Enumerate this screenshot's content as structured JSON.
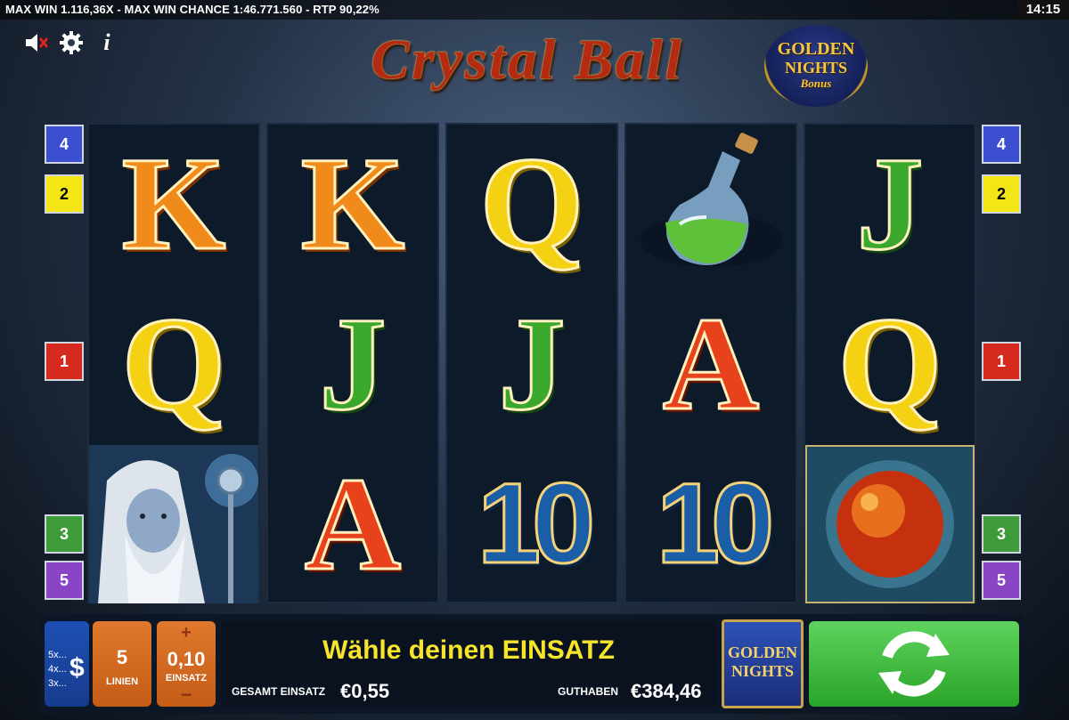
{
  "topbar": {
    "info": "MAX WIN 1.116,36X  -  MAX WIN CHANCE 1:46.771.560  -  RTP 90,22%",
    "clock": "14:15"
  },
  "icons": [
    "sound-off-icon",
    "gear-icon",
    "info-icon"
  ],
  "game": {
    "title": "Crystal Ball",
    "badge": {
      "line1": "GOLDEN",
      "line2": "NIGHTS",
      "line3": "Bonus"
    }
  },
  "reels": [
    [
      "K",
      "Q",
      "wizard"
    ],
    [
      "K",
      "J",
      "A"
    ],
    [
      "Q",
      "J",
      "10"
    ],
    [
      "potion",
      "A",
      "10"
    ],
    [
      "J",
      "Q",
      "crystal-ball"
    ]
  ],
  "paylines_left": [
    {
      "label": "4",
      "color": "#3d4fd1"
    },
    {
      "label": "2",
      "color": "#f2e616"
    },
    {
      "label": "1",
      "color": "#d52b1e"
    },
    {
      "label": "3",
      "color": "#3e9b3a"
    },
    {
      "label": "5",
      "color": "#8a45c6"
    }
  ],
  "paylines_right": [
    {
      "label": "4",
      "color": "#3d4fd1"
    },
    {
      "label": "2",
      "color": "#f2e616"
    },
    {
      "label": "1",
      "color": "#d52b1e"
    },
    {
      "label": "3",
      "color": "#3e9b3a"
    },
    {
      "label": "5",
      "color": "#8a45c6"
    }
  ],
  "controls": {
    "multipliers": [
      "5x...",
      "4x...",
      "3x..."
    ],
    "paytable_symbol": "$",
    "lines_value": "5",
    "lines_label": "LINIEN",
    "bet_plus": "+",
    "bet_value": "0,10",
    "bet_label": "EINSATZ",
    "bet_minus": "−",
    "message": "Wähle deinen EINSATZ",
    "total_bet_label": "GESAMT EINSATZ",
    "total_bet_value": "€0,55",
    "balance_label": "GUTHABEN",
    "balance_value": "€384,46",
    "golden_nights_line1": "GOLDEN",
    "golden_nights_line2": "NIGHTS"
  }
}
